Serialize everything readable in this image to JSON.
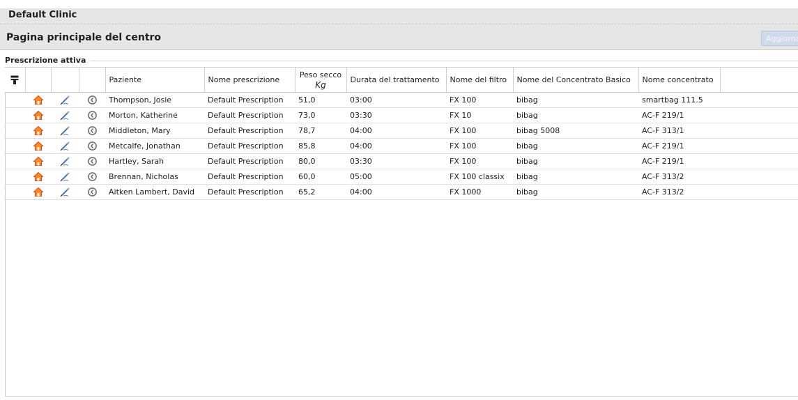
{
  "clinic": {
    "name": "Default Clinic"
  },
  "page": {
    "title": "Pagina principale del centro",
    "refresh_label": "Aggiorna"
  },
  "section": {
    "legend": "Prescrizione attiva"
  },
  "table": {
    "columns": {
      "patient": "Paziente",
      "prescription": "Nome prescrizione",
      "dry_weight": "Peso secco",
      "dry_weight_unit": "Kg",
      "duration": "Durata del trattamento",
      "filter": "Nome del filtro",
      "basic_concentrate": "Nome del Concentrato Basico",
      "concentrate": "Nome concentrato"
    },
    "icons": {
      "filter": "filter-icon",
      "home": "home-icon",
      "edit": "edit-pen-icon",
      "history": "history-clock-icon"
    },
    "colors": {
      "home_orange": "#ff8c1a",
      "home_red": "#e0412a",
      "pen_blue": "#4a78b8",
      "clock_gray": "#707070"
    },
    "rows": [
      {
        "patient": "Thompson, Josie",
        "prescription": "Default Prescription",
        "dry_weight": "51,0",
        "duration": "03:00",
        "filter": "FX 100",
        "basic_concentrate": "bibag",
        "concentrate": "smartbag 111.5"
      },
      {
        "patient": "Morton, Katherine",
        "prescription": "Default Prescription",
        "dry_weight": "73,0",
        "duration": "03:30",
        "filter": "FX 10",
        "basic_concentrate": "bibag",
        "concentrate": "AC-F 219/1"
      },
      {
        "patient": "Middleton, Mary",
        "prescription": "Default Prescription",
        "dry_weight": "78,7",
        "duration": "04:00",
        "filter": "FX 100",
        "basic_concentrate": "bibag 5008",
        "concentrate": "AC-F 313/1"
      },
      {
        "patient": "Metcalfe, Jonathan",
        "prescription": "Default Prescription",
        "dry_weight": "85,8",
        "duration": "04:00",
        "filter": "FX 100",
        "basic_concentrate": "bibag",
        "concentrate": "AC-F 219/1"
      },
      {
        "patient": "Hartley, Sarah",
        "prescription": "Default Prescription",
        "dry_weight": "80,0",
        "duration": "03:30",
        "filter": "FX 100",
        "basic_concentrate": "bibag",
        "concentrate": "AC-F 219/1"
      },
      {
        "patient": "Brennan, Nicholas",
        "prescription": "Default Prescription",
        "dry_weight": "60,0",
        "duration": "05:00",
        "filter": "FX 100 classix",
        "basic_concentrate": "bibag",
        "concentrate": "AC-F 313/2"
      },
      {
        "patient": "Aitken Lambert, David",
        "prescription": "Default Prescription",
        "dry_weight": "65,2",
        "duration": "04:00",
        "filter": "FX 1000",
        "basic_concentrate": "bibag",
        "concentrate": "AC-F 313/2"
      }
    ]
  }
}
